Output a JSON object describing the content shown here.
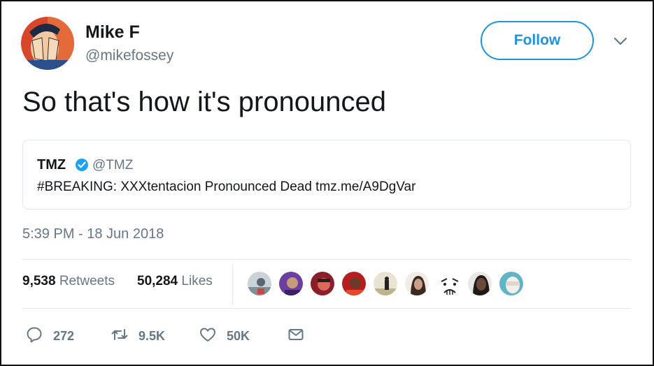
{
  "user": {
    "name": "Mike F",
    "handle": "@mikefossey",
    "follow_label": "Follow"
  },
  "tweet": {
    "text": "So that's how it's pronounced",
    "timestamp": "5:39 PM - 18 Jun 2018"
  },
  "quoted": {
    "name": "TMZ",
    "handle": "@TMZ",
    "text": "#BREAKING: XXXtentacion Pronounced Dead tmz.me/A9DgVar"
  },
  "stats": {
    "retweets_count": "9,538",
    "retweets_label": "Retweets",
    "likes_count": "50,284",
    "likes_label": "Likes"
  },
  "actions": {
    "reply_count": "272",
    "retweet_count": "9.5K",
    "like_count": "50K"
  },
  "colors": {
    "accent": "#1b95e0",
    "secondary_text": "#657786",
    "border": "#e1e8ed"
  },
  "icons": [
    "chevron-down-icon",
    "verified-badge-icon",
    "reply-icon",
    "retweet-icon",
    "heart-icon",
    "envelope-icon"
  ]
}
